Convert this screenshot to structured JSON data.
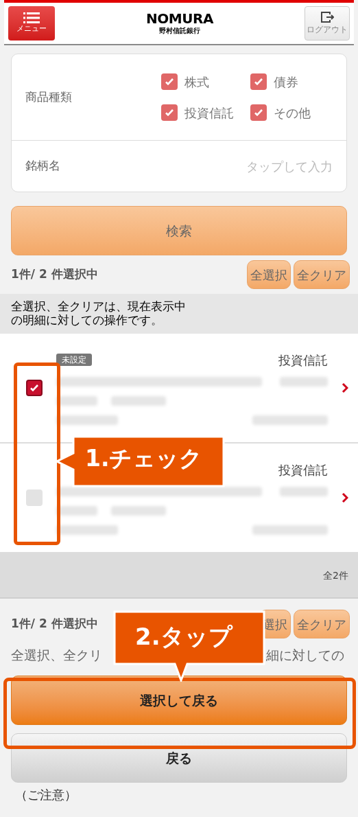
{
  "header": {
    "menu_button": "メニュー",
    "logo": "NOMURA",
    "logo_sub": "野村信託銀行",
    "logout_button": "ログアウト"
  },
  "filter": {
    "product_type_label": "商品種類",
    "options": [
      {
        "label": "株式",
        "checked": true
      },
      {
        "label": "債券",
        "checked": true
      },
      {
        "label": "投資信託",
        "checked": true
      },
      {
        "label": "その他",
        "checked": true
      }
    ],
    "name_label": "銘柄名",
    "name_placeholder": "タップして入力"
  },
  "search_button": "検索",
  "selection_bar": {
    "count": "1件/ 2 件選択中",
    "buttons": [
      "全選択",
      "全クリア"
    ],
    "note_lines": [
      "全選択、全クリアは、現在表示中",
      "の明細に対しての操作です。"
    ]
  },
  "items": [
    {
      "badge": "未設定",
      "category": "投資信託",
      "checked": true
    },
    {
      "category": "投資信託",
      "checked": false
    }
  ],
  "total": "全2件",
  "bottom_bar": {
    "count": "1件/ 2 件選択中",
    "buttons": [
      "選択",
      "全クリア"
    ],
    "note_parts": [
      "全選択、全クリ",
      "細に対しての"
    ]
  },
  "primary_button": "選択して戻る",
  "back_button": "戻る",
  "notice_heading": "（ご注意）",
  "callouts": [
    {
      "text": "1.チェック"
    },
    {
      "text": "2.タップ"
    }
  ]
}
